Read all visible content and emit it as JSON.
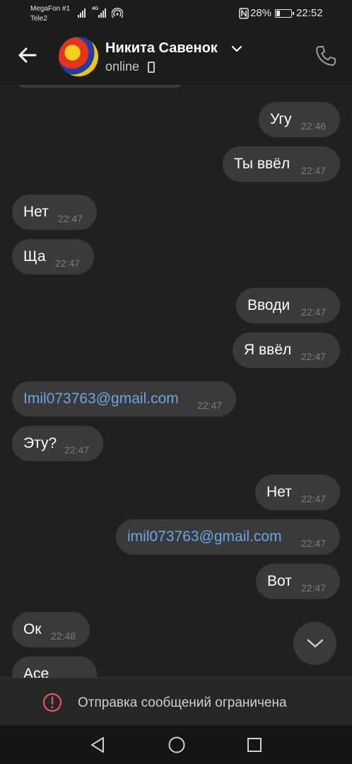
{
  "status_bar": {
    "carrier_1": "MegaFon #1",
    "carrier_2": "Tele2",
    "network": "4G",
    "battery_percent": "28%",
    "battery_level": 0.28,
    "time": "22:52"
  },
  "header": {
    "contact_name": "Никита Савенок",
    "status": "online"
  },
  "messages": [
    {
      "text": "Угу",
      "time": "22:46",
      "outgoing": true,
      "link": false
    },
    {
      "text": "Ты ввёл",
      "time": "22:47",
      "outgoing": true,
      "link": false
    },
    {
      "text": "Нет",
      "time": "22:47",
      "outgoing": false,
      "link": false
    },
    {
      "text": "Ща",
      "time": "22:47",
      "outgoing": false,
      "link": false
    },
    {
      "text": "Вводи",
      "time": "22:47",
      "outgoing": true,
      "link": false
    },
    {
      "text": "Я ввёл",
      "time": "22:47",
      "outgoing": true,
      "link": false
    },
    {
      "text": "Imil073763@gmail.com",
      "time": "22:47",
      "outgoing": false,
      "link": true
    },
    {
      "text": "Эту?",
      "time": "22:47",
      "outgoing": false,
      "link": false
    },
    {
      "text": "Нет",
      "time": "22:47",
      "outgoing": true,
      "link": false
    },
    {
      "text": "imil073763@gmail.com",
      "time": "22:47",
      "outgoing": true,
      "link": true
    },
    {
      "text": "Вот",
      "time": "22:47",
      "outgoing": true,
      "link": false
    },
    {
      "text": "Ок",
      "time": "22:48",
      "outgoing": false,
      "link": false
    },
    {
      "text": "Асе",
      "time": "",
      "outgoing": false,
      "link": false
    }
  ],
  "footer": {
    "restriction_text": "Отправка сообщений ограничена"
  },
  "colors": {
    "background": "#202020",
    "bubble": "#3a3a3a",
    "link": "#6aa5e5",
    "alert": "#e05a5a"
  }
}
